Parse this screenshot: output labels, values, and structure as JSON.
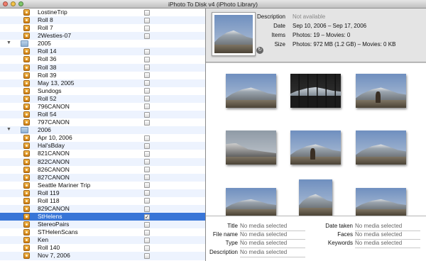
{
  "window": {
    "title": "iPhoto To Disk v4 (iPhoto Library)"
  },
  "library": {
    "rows": [
      {
        "label": "LostineTrip",
        "type": "roll",
        "checked": false
      },
      {
        "label": "Roll 8",
        "type": "roll",
        "checked": false
      },
      {
        "label": "Roll 7",
        "type": "roll",
        "checked": false
      },
      {
        "label": "2Westies-07",
        "type": "roll",
        "checked": false
      },
      {
        "label": "2005",
        "type": "folder",
        "expanded": true
      },
      {
        "label": "Roll 14",
        "type": "roll",
        "checked": false
      },
      {
        "label": "Roll 36",
        "type": "roll",
        "checked": false
      },
      {
        "label": "Roll 38",
        "type": "roll",
        "checked": false
      },
      {
        "label": "Roll 39",
        "type": "roll",
        "checked": false
      },
      {
        "label": "May 13, 2005",
        "type": "roll",
        "checked": false
      },
      {
        "label": "Sundogs",
        "type": "roll",
        "checked": false
      },
      {
        "label": "Roll 52",
        "type": "roll",
        "checked": false
      },
      {
        "label": "796CANON",
        "type": "roll",
        "checked": false
      },
      {
        "label": "Roll 54",
        "type": "roll",
        "checked": false
      },
      {
        "label": "797CANON",
        "type": "roll",
        "checked": false
      },
      {
        "label": "2006",
        "type": "folder",
        "expanded": true
      },
      {
        "label": "Apr 10, 2006",
        "type": "roll",
        "checked": false
      },
      {
        "label": "Hal'sBday",
        "type": "roll",
        "checked": false
      },
      {
        "label": "821CANON",
        "type": "roll",
        "checked": false
      },
      {
        "label": "822CANON",
        "type": "roll",
        "checked": false
      },
      {
        "label": "826CANON",
        "type": "roll",
        "checked": false
      },
      {
        "label": "827CANON",
        "type": "roll",
        "checked": false
      },
      {
        "label": "Seattle Mariner Trip",
        "type": "roll",
        "checked": false
      },
      {
        "label": "Roll 119",
        "type": "roll",
        "checked": false
      },
      {
        "label": "Roll 118",
        "type": "roll",
        "checked": false
      },
      {
        "label": "829CANON",
        "type": "roll",
        "checked": false
      },
      {
        "label": "StHelens",
        "type": "roll",
        "checked": true,
        "selected": true
      },
      {
        "label": "StereoPairs",
        "type": "roll",
        "checked": false
      },
      {
        "label": "STHelenScans",
        "type": "roll",
        "checked": false
      },
      {
        "label": "Ken",
        "type": "roll",
        "checked": false
      },
      {
        "label": "Roll 140",
        "type": "roll",
        "checked": false
      },
      {
        "label": "Nov 7, 2006",
        "type": "roll",
        "checked": false
      }
    ]
  },
  "info": {
    "description_label": "Description",
    "description_value": "Not available",
    "date_label": "Date",
    "date_value": "Sep 10, 2006 – Sep 17, 2006",
    "items_label": "Items",
    "items_value": "Photos: 19 – Movies: 0",
    "size_label": "Size",
    "size_value": "Photos: 972 MB (1.2 GB) – Movies: 0 KB"
  },
  "metadata": {
    "title_label": "Title",
    "title_value": "No media selected",
    "filename_label": "File name",
    "filename_value": "No media selected",
    "type_label": "Type",
    "type_value": "No media selected",
    "description_label": "Description",
    "description_value": "No media selected",
    "datetaken_label": "Date taken",
    "datetaken_value": "No media selected",
    "faces_label": "Faces",
    "faces_value": "No media selected",
    "keywords_label": "Keywords",
    "keywords_value": "No media selected"
  },
  "colors": {
    "selection": "#3875d7",
    "alt_row": "#edf3fe",
    "pane_bg": "#e4e4e4"
  },
  "icons": {
    "roll": "film-roll-icon",
    "folder": "folder-icon",
    "disclosure": "disclosure-triangle-icon"
  }
}
